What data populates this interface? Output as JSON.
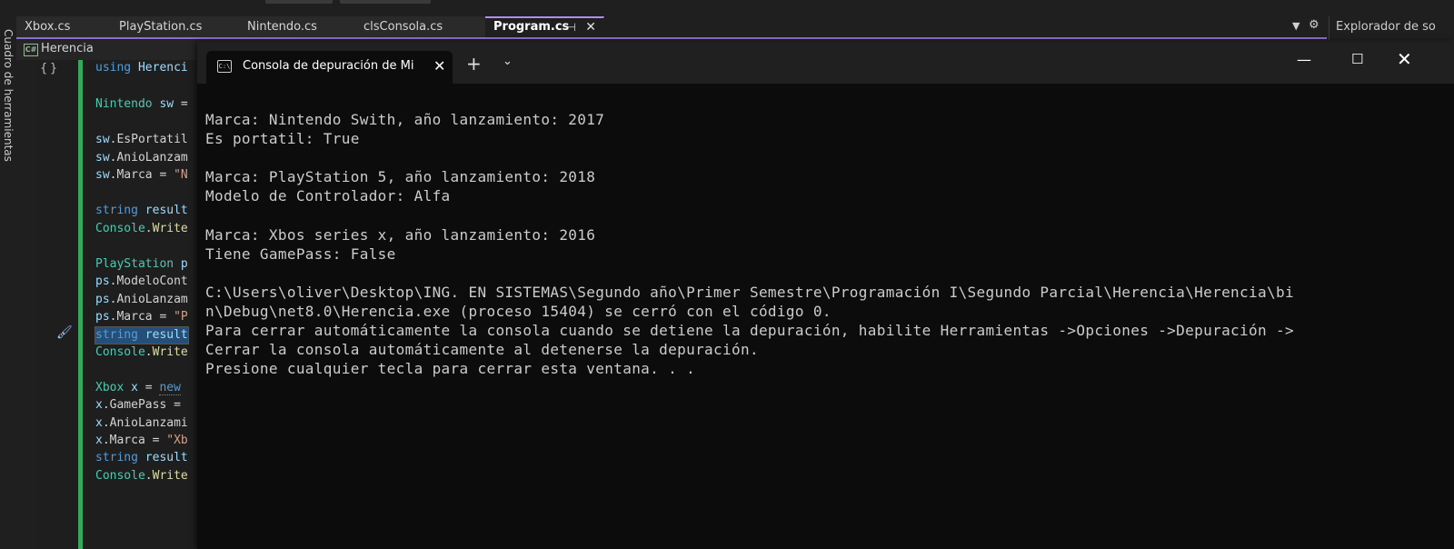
{
  "toolbox": {
    "label": "Cuadro de herramientas"
  },
  "tabs": [
    {
      "label": "Xbox.cs"
    },
    {
      "label": "PlayStation.cs"
    },
    {
      "label": "Nintendo.cs"
    },
    {
      "label": "clsConsola.cs"
    },
    {
      "label": "Program.cs"
    }
  ],
  "tab_controls": {
    "pin": "⊣",
    "close": "✕"
  },
  "solution_explorer": {
    "title": "Explorador de so"
  },
  "navbar": {
    "project": "Herencia",
    "icon_text": "C#"
  },
  "code": {
    "l1a": "using ",
    "l1b": "Herenci",
    "l2a": "Nintendo ",
    "l2b": "sw",
    "l3a": "sw",
    "l3b": ".EsPortatil",
    "l4a": "sw",
    "l4b": ".AnioLanzam",
    "l5a": "sw",
    "l5b": ".Marca = ",
    "l5c": "\"N",
    "l6a": "string ",
    "l6b": "result",
    "l7a": "Console",
    "l7b": ".",
    "l7c": "Write",
    "l8a": "PlayStation ",
    "l8b": "p",
    "l9a": "ps",
    "l9b": ".ModeloCont",
    "l10a": "ps",
    "l10b": ".AnioLanzam",
    "l11a": "ps",
    "l11b": ".Marca = ",
    "l11c": "\"P",
    "l12a": "string ",
    "l12b": "result",
    "l13a": "Console",
    "l13b": ".",
    "l13c": "Write",
    "l14a": "Xbox ",
    "l14b": "x",
    "l14c": " = ",
    "l14d": "new",
    "l15a": "x",
    "l15b": ".GamePass =",
    "l16a": "x",
    "l16b": ".AnioLanzami",
    "l17a": "x",
    "l17b": ".Marca = ",
    "l17c": "\"Xb",
    "l18a": "string ",
    "l18b": "result",
    "l19a": "Console",
    "l19b": ".",
    "l19c": "Write"
  },
  "console": {
    "tab_title": "Consola de depuración de Mi",
    "lines": [
      "Marca: Nintendo Swith, año lanzamiento: 2017",
      "Es portatil: True",
      "Marca: PlayStation 5, año lanzamiento: 2018",
      "Modelo de Controlador: Alfa",
      "Marca: Xbos series x, año lanzamiento: 2016",
      "Tiene GamePass: False",
      "C:\\Users\\oliver\\Desktop\\ING. EN SISTEMAS\\Segundo año\\Primer Semestre\\Programación I\\Segundo Parcial\\Herencia\\Herencia\\bi",
      "n\\Debug\\net8.0\\Herencia.exe (proceso 15404) se cerró con el código 0.",
      "Para cerrar automáticamente la consola cuando se detiene la depuración, habilite Herramientas ->Opciones ->Depuración ->",
      "Cerrar la consola automáticamente al detenerse la depuración.",
      "Presione cualquier tecla para cerrar esta ventana. . ."
    ]
  },
  "colors": {
    "accent": "#8c6fd1",
    "change_bar": "#36a85b",
    "console_bg": "#0c0c0c",
    "console_text": "#cccccc"
  }
}
